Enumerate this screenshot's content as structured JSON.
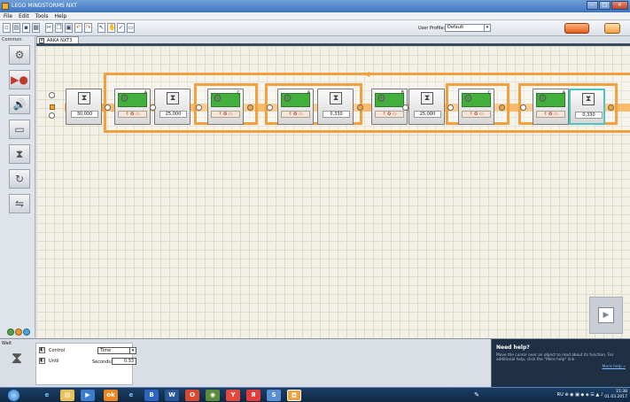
{
  "window": {
    "title": "LEGO MINDSTORMS NXT",
    "buttons": [
      "minimize",
      "maximize",
      "close"
    ]
  },
  "menu": {
    "items": [
      "File",
      "Edit",
      "Tools",
      "Help"
    ]
  },
  "toolbar": {
    "icons": [
      "new-icon",
      "open-icon",
      "save-icon",
      "print-icon",
      "cut-icon",
      "copy-icon",
      "paste-icon",
      "undo-icon",
      "redo-icon",
      "pointer-icon",
      "pan-icon",
      "comment-icon",
      "custom-palette-icon"
    ],
    "user_profile_label": "User Profile:",
    "user_profile_value": "Default"
  },
  "palette": {
    "title": "Common",
    "tiles": [
      "move-icon",
      "record-play-icon",
      "sound-icon",
      "display-icon",
      "wait-icon",
      "loop-icon",
      "switch-icon"
    ]
  },
  "document": {
    "tab_label": "ARKA NXT3"
  },
  "program": {
    "wait_values": [
      "30,000",
      "25,000",
      "0,330",
      "25,000",
      "0,330"
    ],
    "motor_ports": [
      "A",
      "C",
      "A",
      "B",
      "C",
      "A"
    ],
    "motor_icons": "↑ ✪ ▭"
  },
  "config": {
    "block_name": "Wait",
    "control_label": "Control",
    "control_value": "Time",
    "until_label": "Until",
    "seconds_label": "Seconds:",
    "seconds_value": "0.33"
  },
  "help": {
    "title": "Need help?",
    "text": "Move the cursor over an object to read about its function. For additional help, click the \"More help\" link.",
    "more_link": "More help »"
  },
  "taskbar": {
    "tray_lang": "RU",
    "clock_time": "15:38",
    "clock_date": "01.03.2017"
  }
}
